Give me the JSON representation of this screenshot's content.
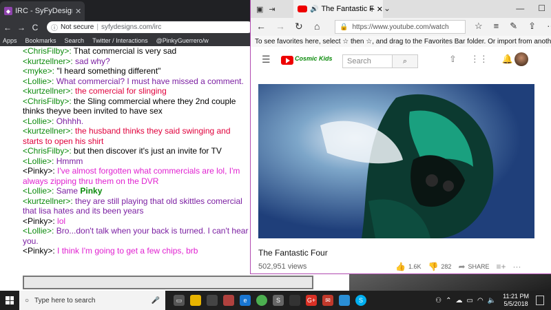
{
  "chrome": {
    "tab_title": "IRC - SyFyDesigns.com",
    "tab_close": "✕",
    "nav": {
      "back": "←",
      "forward": "→",
      "reload": "C"
    },
    "address": {
      "security": "Not secure",
      "separator": "|",
      "url": "syfydesigns.com/irc"
    },
    "bookmarks": [
      "Apps",
      "Bookmarks",
      "Search",
      "Twitter / Interactions",
      "@PinkyGuerrero/w"
    ]
  },
  "chat": {
    "lines": [
      {
        "nick": "<ChrisFilby>:",
        "nick_color": "green",
        "text": " That commercial is very sad",
        "text_color": "black"
      },
      {
        "nick": "<kurtzellner>:",
        "nick_color": "green",
        "text": " sad why?",
        "text_color": "purple"
      },
      {
        "nick": "<myke>:",
        "nick_color": "green",
        "text": " \"I heard something different\"",
        "text_color": "black"
      },
      {
        "nick": "<Lollie>:",
        "nick_color": "green",
        "text": " What commercial? I must have missed a comment.",
        "text_color": "purple"
      },
      {
        "nick": "<kurtzellner>:",
        "nick_color": "green",
        "text": " the comercial for slinging",
        "text_color": "red"
      },
      {
        "nick": "<ChrisFilby>:",
        "nick_color": "green",
        "text": " the Sling commercial where they 2nd couple thinks theyve been invited to have sex",
        "text_color": "black"
      },
      {
        "nick": "<Lollie>:",
        "nick_color": "green",
        "text": " Ohhhh.",
        "text_color": "purple"
      },
      {
        "nick": "<kurtzellner>:",
        "nick_color": "green",
        "text": " the husband thinks they said swinging and starts to open his shirt",
        "text_color": "red"
      },
      {
        "nick": "<ChrisFilby>:",
        "nick_color": "green",
        "text": " but then discover it's just an invite for TV",
        "text_color": "black"
      },
      {
        "nick": "<Lollie>:",
        "nick_color": "green",
        "text": " Hmmm",
        "text_color": "purple"
      },
      {
        "nick": "<Pinky>:",
        "nick_color": "black",
        "text": " I've almost forgotten what commercials are lol, I'm always zipping thru them on the DVR",
        "text_color": "pink"
      },
      {
        "nick": "<Lollie>:",
        "nick_color": "green",
        "text": " Same ",
        "text_color": "purple",
        "extra": "Pinky"
      },
      {
        "nick": "<kurtzellner>:",
        "nick_color": "green",
        "text": " they are still playing that old skittles comercial that lisa hates and its been years",
        "text_color": "purple"
      },
      {
        "nick": "<Pinky>:",
        "nick_color": "black",
        "text": " lol",
        "text_color": "pink"
      },
      {
        "nick": "<Lollie>:",
        "nick_color": "green",
        "text": " Bro...don't talk when your back is turned. I can't hear you.",
        "text_color": "purple"
      },
      {
        "nick": "<Pinky>:",
        "nick_color": "black",
        "text": " I think I'm going to get a few chips, brb",
        "text_color": "pink"
      }
    ]
  },
  "edge": {
    "tab_title": "The Fantastic Four -",
    "tab_close": "✕",
    "new_tab": "+",
    "url": "https://www.youtube.com/watch",
    "favorites_hint": "To see favorites here, select ☆ then ☆, and drag to the Favorites Bar folder. Or import from another bro",
    "search_placeholder": "Search",
    "logo_text": "Cosmic Kids"
  },
  "video": {
    "title": "The Fantastic Four",
    "views": "502,951 views",
    "likes": "1.6K",
    "dislikes": "282",
    "share": "SHARE"
  },
  "taskbar": {
    "search_placeholder": "Type here to search",
    "time": "11:21 PM",
    "date": "5/5/2018"
  }
}
